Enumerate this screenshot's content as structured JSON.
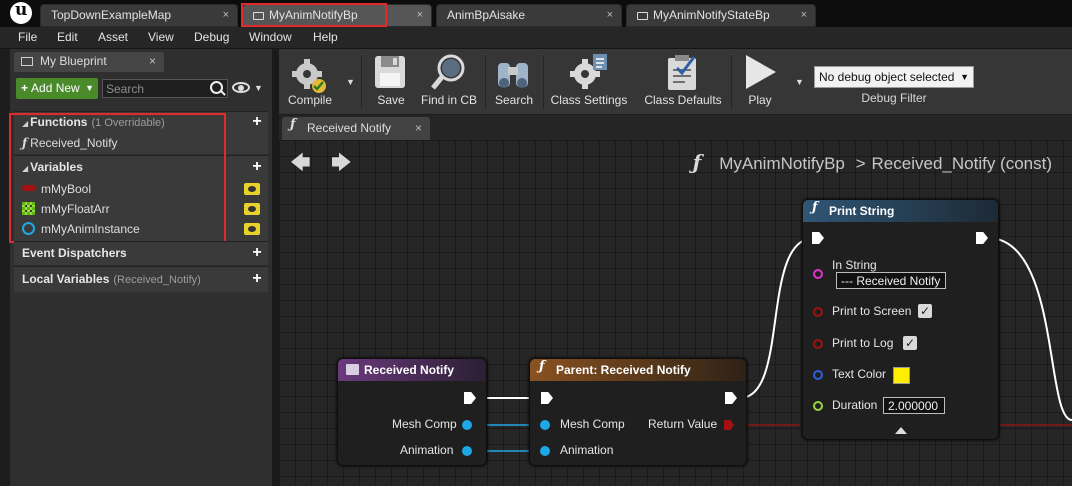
{
  "tabs": [
    {
      "label": "TopDownExampleMap",
      "active": false
    },
    {
      "label": "MyAnimNotifyBp",
      "active": true
    },
    {
      "label": "AnimBpAisake",
      "active": false
    },
    {
      "label": "MyAnimNotifyStateBp",
      "active": false
    }
  ],
  "tab_close_glyph": "×",
  "menu": [
    "File",
    "Edit",
    "Asset",
    "View",
    "Debug",
    "Window",
    "Help"
  ],
  "my_blueprint": {
    "tab_label": "My Blueprint",
    "add_new_label": "Add New",
    "search_placeholder": "Search",
    "sections": {
      "functions": {
        "title": "Functions",
        "sub": "(1 Overridable)",
        "items": [
          "Received_Notify"
        ]
      },
      "variables": {
        "title": "Variables",
        "items": [
          {
            "name": "mMyBool",
            "type": "bool",
            "color": "#a31111"
          },
          {
            "name": "mMyFloatArr",
            "type": "float-array",
            "color": "#9ad93b"
          },
          {
            "name": "mMyAnimInstance",
            "type": "object",
            "color": "#1ea7e6"
          }
        ]
      },
      "event_dispatchers": {
        "title": "Event Dispatchers"
      },
      "local_variables": {
        "title": "Local Variables",
        "sub": "(Received_Notify)"
      }
    }
  },
  "toolbar": {
    "buttons": [
      "Compile",
      "Save",
      "Find in CB",
      "Search",
      "Class Settings",
      "Class Defaults",
      "Play"
    ],
    "debug_object": "No debug object selected",
    "debug_filter_label": "Debug Filter"
  },
  "graph": {
    "tab_label": "Received Notify",
    "breadcrumb": {
      "blueprint": "MyAnimNotifyBp",
      "separator": ">",
      "function": "Received_Notify (const)"
    },
    "nodes": {
      "entry": {
        "title": "Received Notify",
        "head_color": "#6b3a7e",
        "pins": [
          "Mesh Comp",
          "Animation"
        ]
      },
      "parent": {
        "title": "Parent: Received Notify",
        "head_color": "#7a4a21",
        "inputs": [
          "Mesh Comp",
          "Animation"
        ],
        "output": "Return Value"
      },
      "print": {
        "title": "Print String",
        "head_color": "#2b4a63",
        "in_string_label": "In String",
        "in_string_value": "--- Received Notify",
        "print_to_screen_label": "Print to Screen",
        "print_to_screen": true,
        "print_to_log_label": "Print to Log",
        "print_to_log": true,
        "text_color_label": "Text Color",
        "text_color": "#ffee00",
        "duration_label": "Duration",
        "duration": "2.000000",
        "checkmark": "✓"
      }
    }
  },
  "colors": {
    "accent_red": "#e12b2b",
    "object_pin": "#1ea7e6",
    "string_pin": "#e42fd0",
    "bool_pin": "#a31111",
    "float_pin": "#9ad93b",
    "linear_color_pin": "#2f5fe0"
  }
}
